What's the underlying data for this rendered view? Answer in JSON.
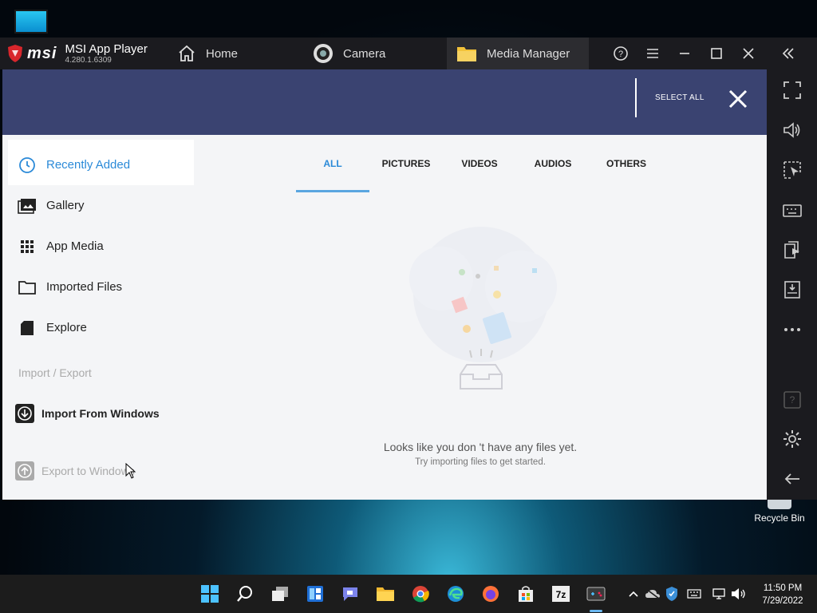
{
  "titlebar": {
    "brand_logo": "msi",
    "app_name": "MSI App Player",
    "version": "4.280.1.6309",
    "tabs": [
      {
        "label": "Home",
        "icon": "home-icon"
      },
      {
        "label": "Camera",
        "icon": "camera-icon"
      },
      {
        "label": "Media Manager",
        "icon": "folder-icon"
      }
    ]
  },
  "header": {
    "select_all": "SELECT ALL"
  },
  "sidebar": {
    "items": [
      {
        "label": "Recently Added",
        "icon": "clock-icon"
      },
      {
        "label": "Gallery",
        "icon": "gallery-icon"
      },
      {
        "label": "App Media",
        "icon": "grid-icon"
      },
      {
        "label": "Imported Files",
        "icon": "folder-outline-icon"
      },
      {
        "label": "Explore",
        "icon": "sd-card-icon"
      }
    ],
    "section_label": "Import / Export",
    "import_label": "Import From Windows",
    "export_label": "Export to Windows"
  },
  "content": {
    "tabs": [
      "ALL",
      "PICTURES",
      "VIDEOS",
      "AUDIOS",
      "OTHERS"
    ],
    "active_tab": "ALL",
    "empty_title": "Looks like you don 't have any files yet.",
    "empty_subtitle": "Try importing files to get started."
  },
  "desktop": {
    "recycle_bin_label": "Recycle Bin"
  },
  "taskbar": {
    "time": "11:50 PM",
    "date": "7/29/2022"
  },
  "colors": {
    "header_bg": "#3a4371",
    "accent": "#2b8ad8",
    "titlebar_bg": "#1b1b1f"
  }
}
